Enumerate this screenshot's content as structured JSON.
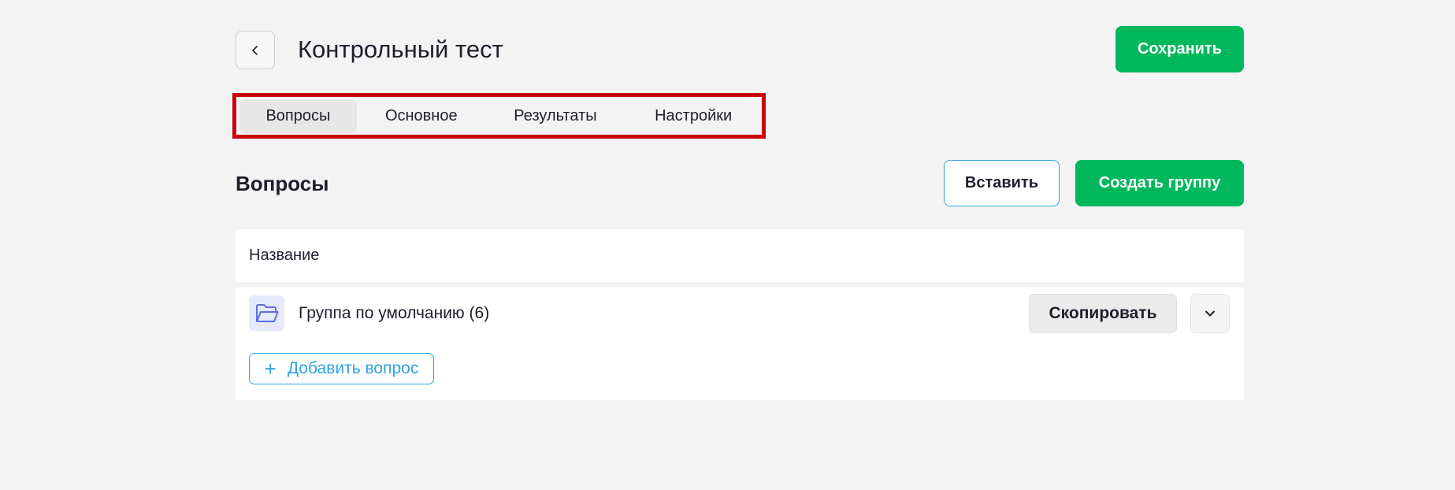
{
  "header": {
    "title": "Контрольный тест",
    "save_label": "Сохранить"
  },
  "tabs": [
    {
      "label": "Вопросы",
      "active": true
    },
    {
      "label": "Основное",
      "active": false
    },
    {
      "label": "Результаты",
      "active": false
    },
    {
      "label": "Настройки",
      "active": false
    }
  ],
  "section": {
    "title": "Вопросы",
    "insert_label": "Вставить",
    "create_group_label": "Создать группу"
  },
  "table": {
    "column_name": "Название"
  },
  "group": {
    "name": "Группа по умолчанию (6)",
    "copy_label": "Скопировать",
    "add_question_label": "Добавить вопрос"
  },
  "icons": {
    "back": "chevron-left-icon",
    "folder": "folder-open-icon",
    "expand": "chevron-down-icon",
    "add": "plus-icon"
  },
  "colors": {
    "accent_green": "#00b85c",
    "accent_blue": "#2ea3e0",
    "highlight_red": "#c8030a",
    "background": "#f3f3f3"
  }
}
